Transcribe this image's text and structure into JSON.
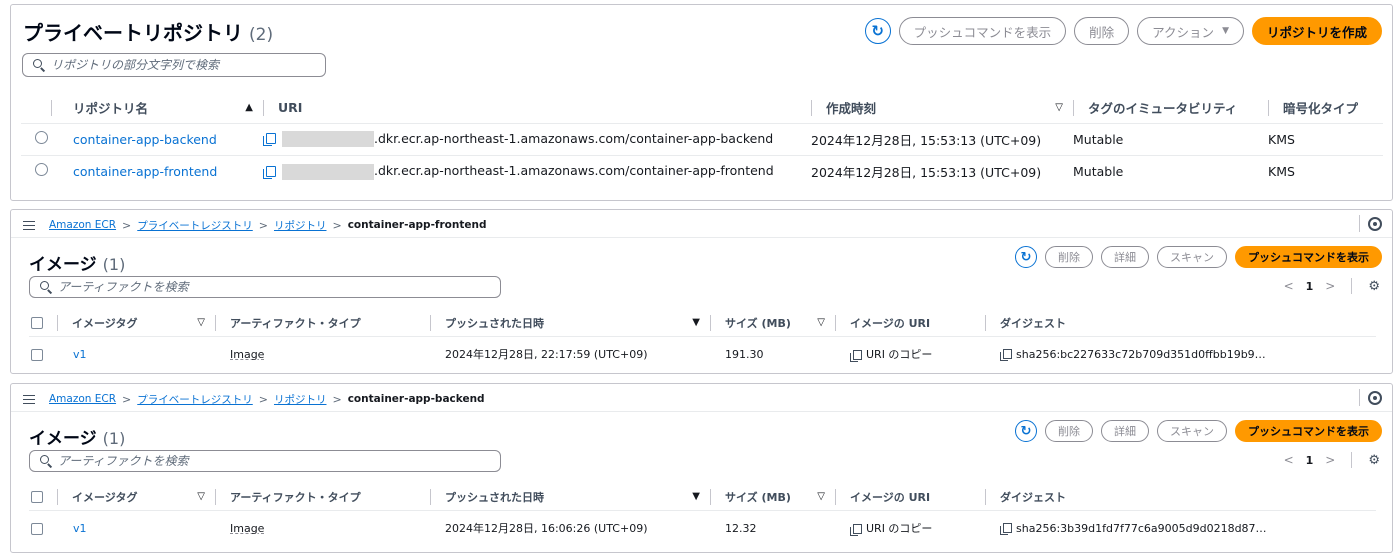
{
  "repo_panel": {
    "title": "プライベートリポジトリ",
    "count": "(2)",
    "search_placeholder": "リポジトリの部分文字列で検索",
    "buttons": {
      "push_commands": "プッシュコマンドを表示",
      "delete": "削除",
      "actions": "アクション",
      "create": "リポジトリを作成"
    },
    "columns": [
      "リポジトリ名",
      "URI",
      "作成時刻",
      "タグのイミュータビリティ",
      "暗号化タイプ"
    ],
    "rows": [
      {
        "name": "container-app-backend",
        "uri": ".dkr.ecr.ap-northeast-1.amazonaws.com/container-app-backend",
        "created": "2024年12月28日, 15:53:13 (UTC+09)",
        "mutability": "Mutable",
        "encryption": "KMS"
      },
      {
        "name": "container-app-frontend",
        "uri": ".dkr.ecr.ap-northeast-1.amazonaws.com/container-app-frontend",
        "created": "2024年12月28日, 15:53:13 (UTC+09)",
        "mutability": "Mutable",
        "encryption": "KMS"
      }
    ]
  },
  "frontend_panel": {
    "breadcrumb": [
      "Amazon ECR",
      "プライベートレジストリ",
      "リポジトリ",
      "container-app-frontend"
    ],
    "title": "イメージ",
    "count": "(1)",
    "search_placeholder": "アーティファクトを検索",
    "buttons": {
      "delete": "削除",
      "details": "詳細",
      "scan": "スキャン",
      "push_commands": "プッシュコマンドを表示"
    },
    "page": "1",
    "columns": [
      "イメージタグ",
      "アーティファクト・タイプ",
      "プッシュされた日時",
      "サイズ (MB)",
      "イメージの URI",
      "ダイジェスト"
    ],
    "rows": [
      {
        "tag": "v1",
        "type": "Image",
        "pushed": "2024年12月28日, 22:17:59 (UTC+09)",
        "size": "191.30",
        "uri": "URI のコピー",
        "digest": "sha256:bc227633c72b709d351d0ffbb19b9…"
      }
    ]
  },
  "backend_panel": {
    "breadcrumb": [
      "Amazon ECR",
      "プライベートレジストリ",
      "リポジトリ",
      "container-app-backend"
    ],
    "title": "イメージ",
    "count": "(1)",
    "search_placeholder": "アーティファクトを検索",
    "buttons": {
      "delete": "削除",
      "details": "詳細",
      "scan": "スキャン",
      "push_commands": "プッシュコマンドを表示"
    },
    "page": "1",
    "columns": [
      "イメージタグ",
      "アーティファクト・タイプ",
      "プッシュされた日時",
      "サイズ (MB)",
      "イメージの URI",
      "ダイジェスト"
    ],
    "rows": [
      {
        "tag": "v1",
        "type": "Image",
        "pushed": "2024年12月28日, 16:06:26 (UTC+09)",
        "size": "12.32",
        "uri": "URI のコピー",
        "digest": "sha256:3b39d1fd7f77c6a9005d9d0218d87…"
      }
    ]
  },
  "colors": {
    "accent": "#0972d3",
    "primary_button": "#ff9900",
    "border": "#c6c6cd"
  },
  "icons": [
    "refresh-icon",
    "search-icon",
    "copy-icon",
    "hamburger-icon",
    "help-icon",
    "gear-icon",
    "sort-asc-icon",
    "sort-desc-icon",
    "caret-down-icon"
  ]
}
